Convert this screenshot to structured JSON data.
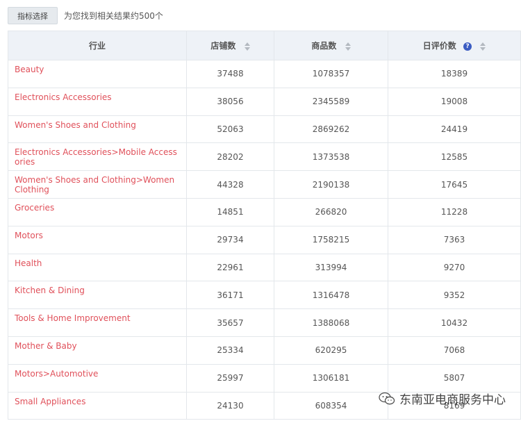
{
  "toolbar": {
    "filter_button": "指标选择",
    "result_text": "为您找到相关结果约500个"
  },
  "table": {
    "headers": [
      "行业",
      "店铺数",
      "商品数",
      "日评价数"
    ],
    "rows": [
      {
        "category": "Beauty",
        "shops": "37488",
        "products": "1078357",
        "reviews": "18389"
      },
      {
        "category": "Electronics Accessories",
        "shops": "38056",
        "products": "2345589",
        "reviews": "19008"
      },
      {
        "category": "Women's Shoes and Clothing",
        "shops": "52063",
        "products": "2869262",
        "reviews": "24419"
      },
      {
        "category": "Electronics Accessories>Mobile Accessories",
        "shops": "28202",
        "products": "1373538",
        "reviews": "12585"
      },
      {
        "category": "Women's Shoes and Clothing>Women Clothing",
        "shops": "44328",
        "products": "2190138",
        "reviews": "17645"
      },
      {
        "category": "Groceries",
        "shops": "14851",
        "products": "266820",
        "reviews": "11228"
      },
      {
        "category": "Motors",
        "shops": "29734",
        "products": "1758215",
        "reviews": "7363"
      },
      {
        "category": "Health",
        "shops": "22961",
        "products": "313994",
        "reviews": "9270"
      },
      {
        "category": "Kitchen & Dining",
        "shops": "36171",
        "products": "1316478",
        "reviews": "9352"
      },
      {
        "category": "Tools & Home Improvement",
        "shops": "35657",
        "products": "1388068",
        "reviews": "10432"
      },
      {
        "category": "Mother & Baby",
        "shops": "25334",
        "products": "620295",
        "reviews": "7068"
      },
      {
        "category": "Motors>Automotive",
        "shops": "25997",
        "products": "1306181",
        "reviews": "5807"
      },
      {
        "category": "Small Appliances",
        "shops": "24130",
        "products": "608354",
        "reviews": "8169"
      }
    ]
  },
  "watermark": {
    "text": "东南亚电商服务中心",
    "icon": "wechat-icon"
  },
  "colors": {
    "link": "#e0505a",
    "header_bg": "#eef2f7",
    "help_icon": "#3b5cc2"
  }
}
